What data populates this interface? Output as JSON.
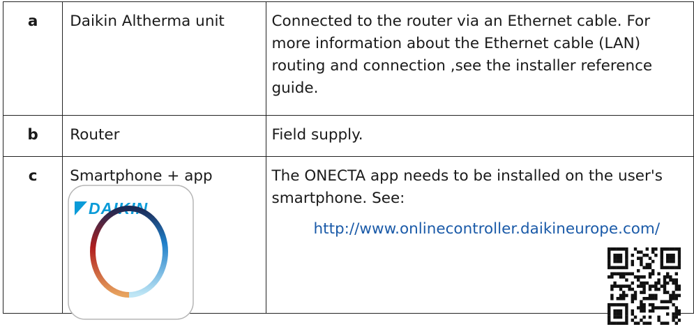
{
  "rows": [
    {
      "label": "a",
      "device": "Daikin Altherma unit",
      "description": "Connected to the router via an Ethernet cable. For more information about the Ethernet cable (LAN) routing and connection ,see the installer reference guide."
    },
    {
      "label": "b",
      "device": "Router",
      "description": "Field supply."
    },
    {
      "label": "c",
      "device": "Smartphone + app",
      "description": "The ONECTA app needs to be installed on the user's smartphone. See:",
      "link": "http://www.onlinecontroller.daikineurope.com/",
      "app_icon_text": "DAIKIN"
    }
  ],
  "colors": {
    "link": "#1a5aa8",
    "daikin_blue": "#0a9bd8",
    "border": "#222222"
  },
  "icons": [
    "daikin-app-icon",
    "qr-code-icon"
  ]
}
